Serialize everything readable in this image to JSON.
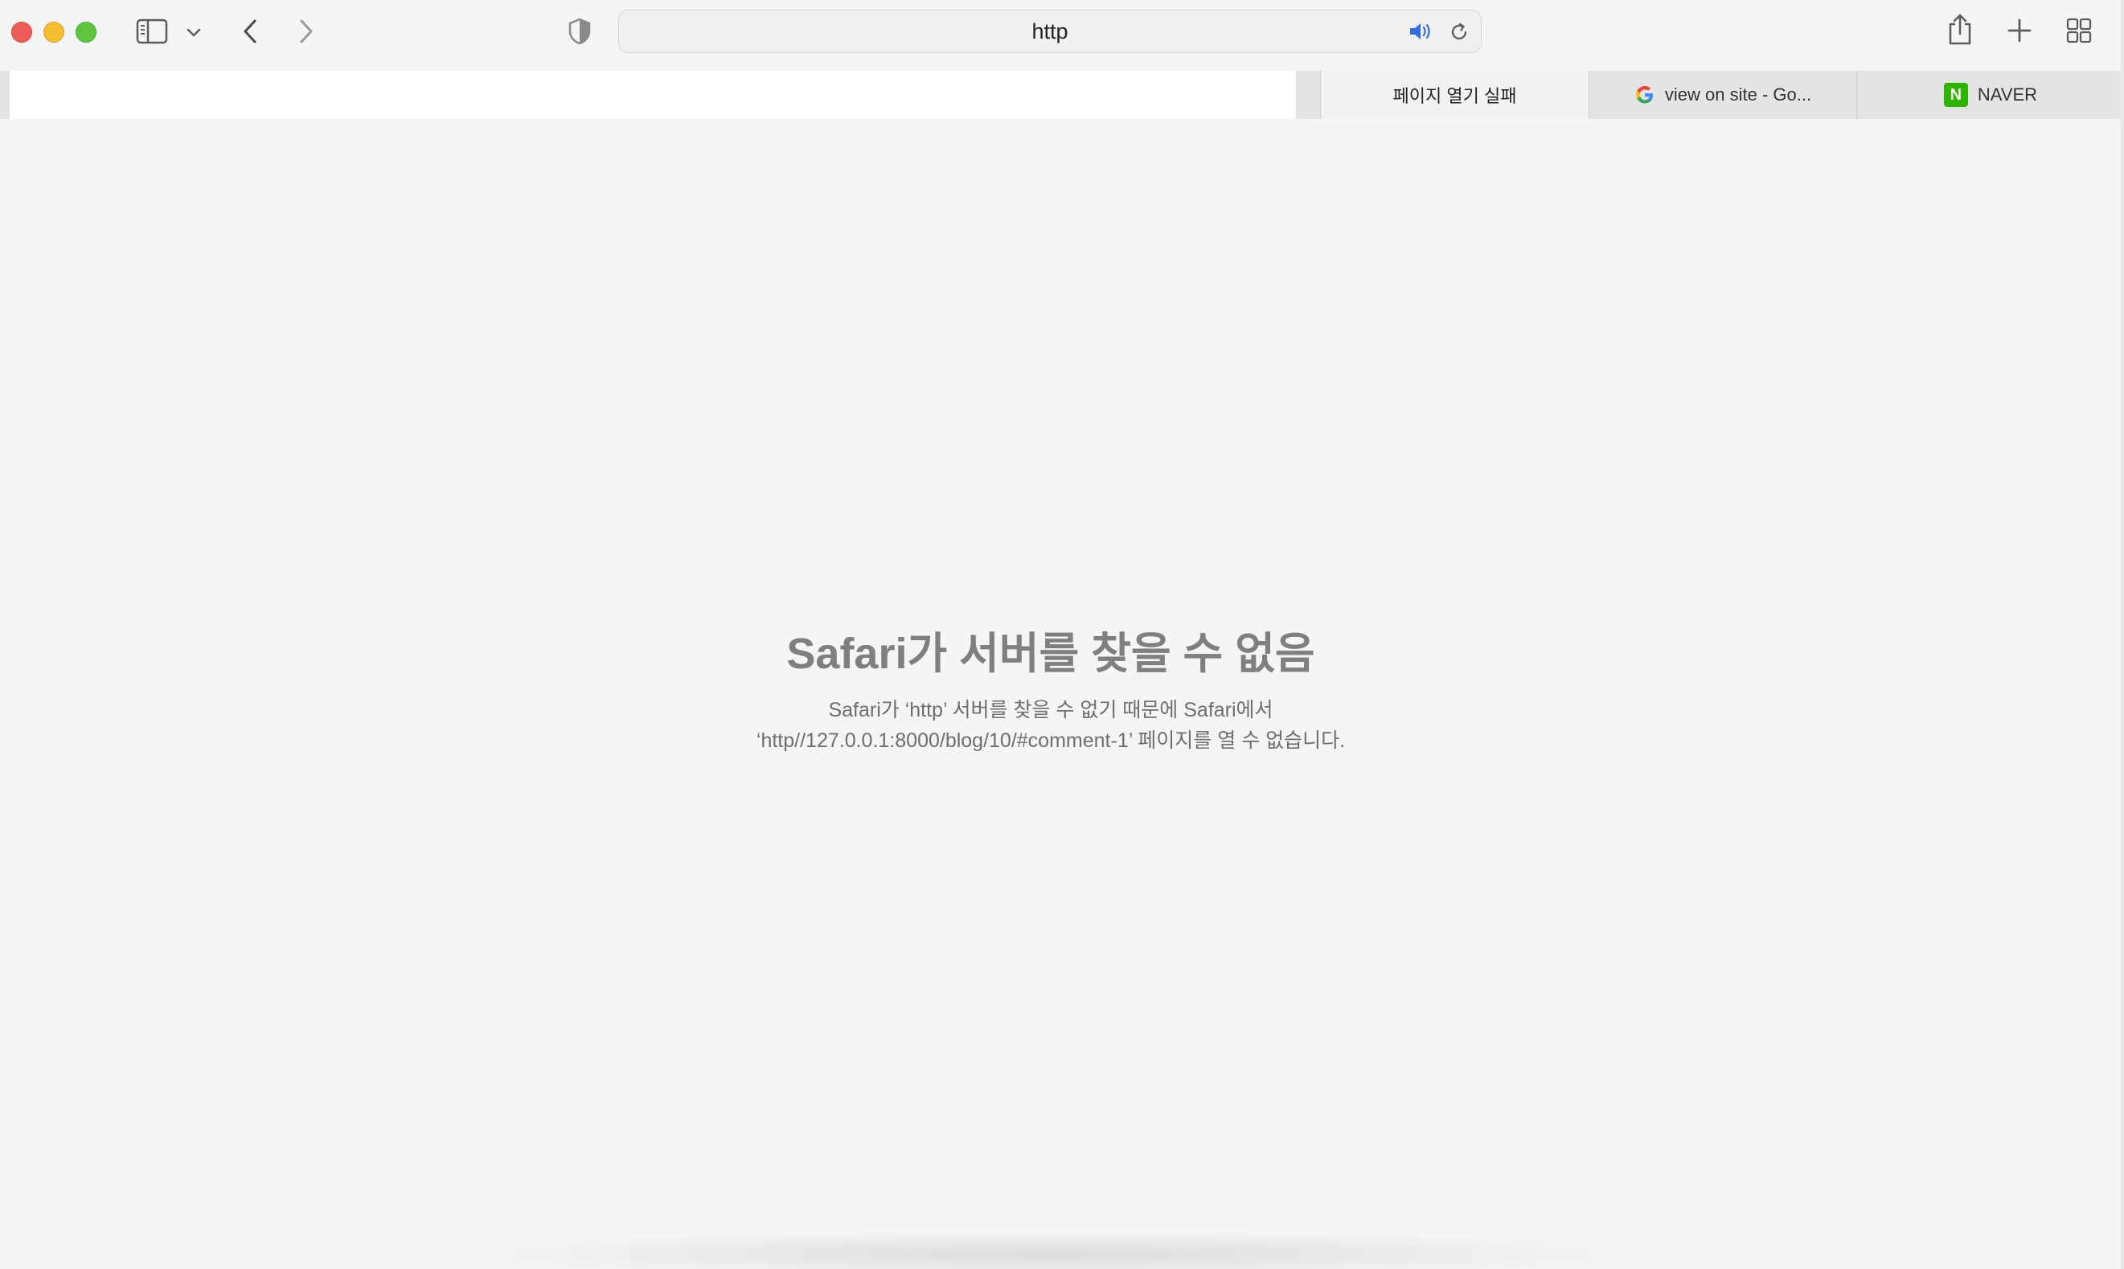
{
  "address_bar": {
    "url": "http"
  },
  "tabs": [
    {
      "label": "페이지 열기 실패",
      "favicon": "none",
      "active": true
    },
    {
      "label": "view on site - Go...",
      "favicon": "google-icon",
      "active": false
    },
    {
      "label": "NAVER",
      "favicon": "naver-icon",
      "active": false
    }
  ],
  "naver_favicon_letter": "N",
  "error": {
    "title": "Safari가 서버를 찾을 수 없음",
    "line1": "Safari가 ‘http’ 서버를 찾을 수 없기 때문에 Safari에서",
    "line2": "‘http//127.0.0.1:8000/blog/10/#comment-1’ 페이지를 열 수 없습니다."
  },
  "colors": {
    "close": "#ee5c56",
    "minimize": "#f5bd31",
    "maximize": "#5fc43e",
    "speaker_accent": "#2f6fe0",
    "naver_green": "#2db400"
  }
}
